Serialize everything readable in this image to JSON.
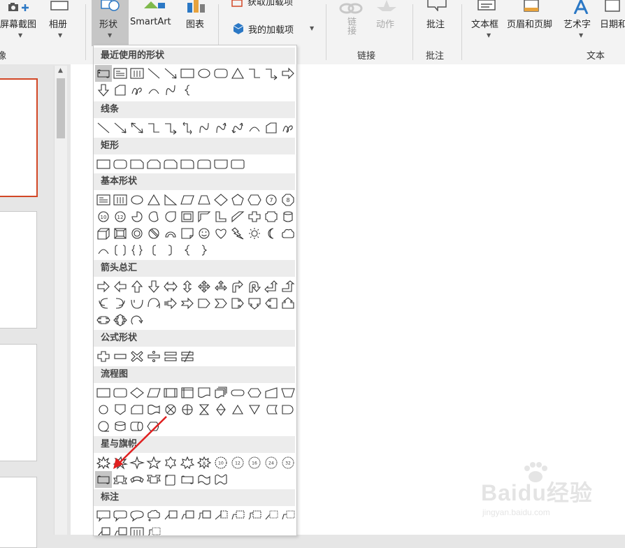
{
  "ribbon": {
    "screenshot_label": "屏幕截图",
    "album_label": "相册",
    "shapes_label": "形状",
    "smartart_label": "SmartArt",
    "chart_label": "图表",
    "get_addins_label": "获取加载项",
    "my_addins_label": "我的加载项",
    "link_label": "链接",
    "action_label": "动作",
    "comment_label": "批注",
    "textbox_label": "文本框",
    "header_footer_label": "页眉和页脚",
    "wordart_label": "艺术字",
    "date_label": "日期和",
    "groups": {
      "images_partial": "像",
      "links": "链接",
      "comments": "批注",
      "text": "文本"
    }
  },
  "shapes_menu": {
    "categories": {
      "recent": "最近使用的形状",
      "lines": "线条",
      "rectangles": "矩形",
      "basic": "基本形状",
      "arrows": "箭头总汇",
      "equation": "公式形状",
      "flowchart": "流程图",
      "stars": "星与旗帜",
      "callouts": "标注"
    },
    "highlighted_shape": "horizontal-scroll-icon"
  },
  "colors": {
    "accent": "#d24726",
    "annotation_arrow": "#e02020",
    "hover": "#c6c6c6"
  },
  "watermark": {
    "brand": "Baidu经验",
    "site": "jingyan.baidu.com"
  }
}
